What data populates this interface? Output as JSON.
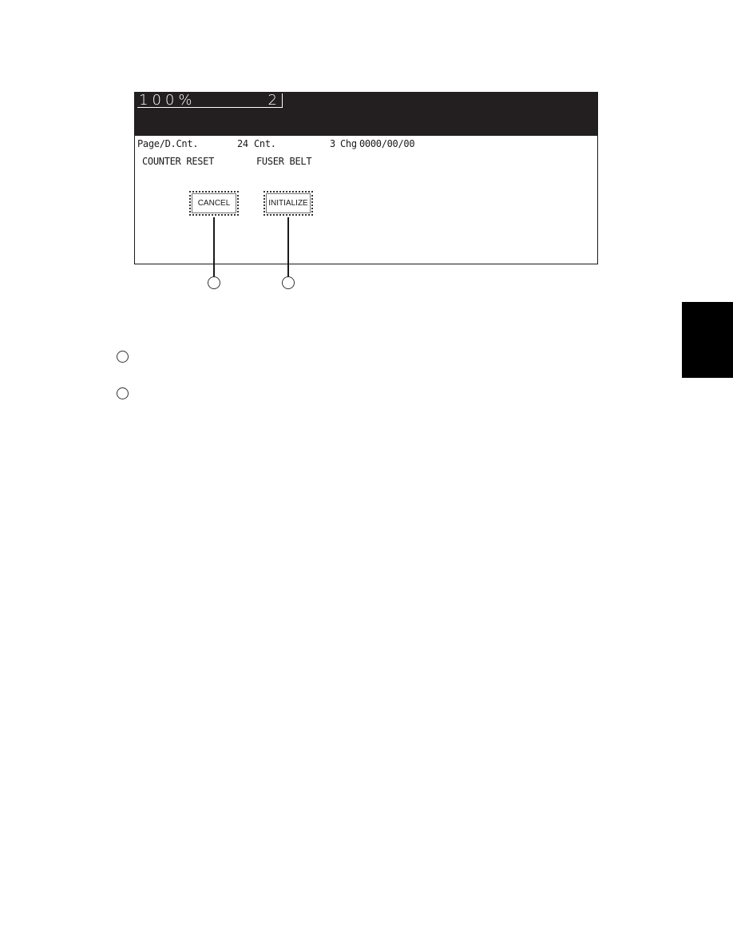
{
  "screen": {
    "zoom_ratio": "100%",
    "copy_count": "2",
    "info": {
      "page_count_label": "Page/D.Cnt.",
      "page_count_value": "24",
      "count_label": "Cnt.",
      "count_value": "3",
      "change_label": "Chg",
      "change_date": "0000/00/00"
    },
    "mode_title": "COUNTER RESET",
    "item_name": "FUSER BELT",
    "buttons": {
      "cancel": "CANCEL",
      "initialize": "INITIALIZE"
    }
  },
  "callouts": [
    "",
    ""
  ],
  "legend": [
    {
      "marker": "",
      "text": ""
    },
    {
      "marker": "",
      "text": ""
    }
  ],
  "colors": {
    "display_bar": "#231f20",
    "side_tab": "#000000"
  }
}
